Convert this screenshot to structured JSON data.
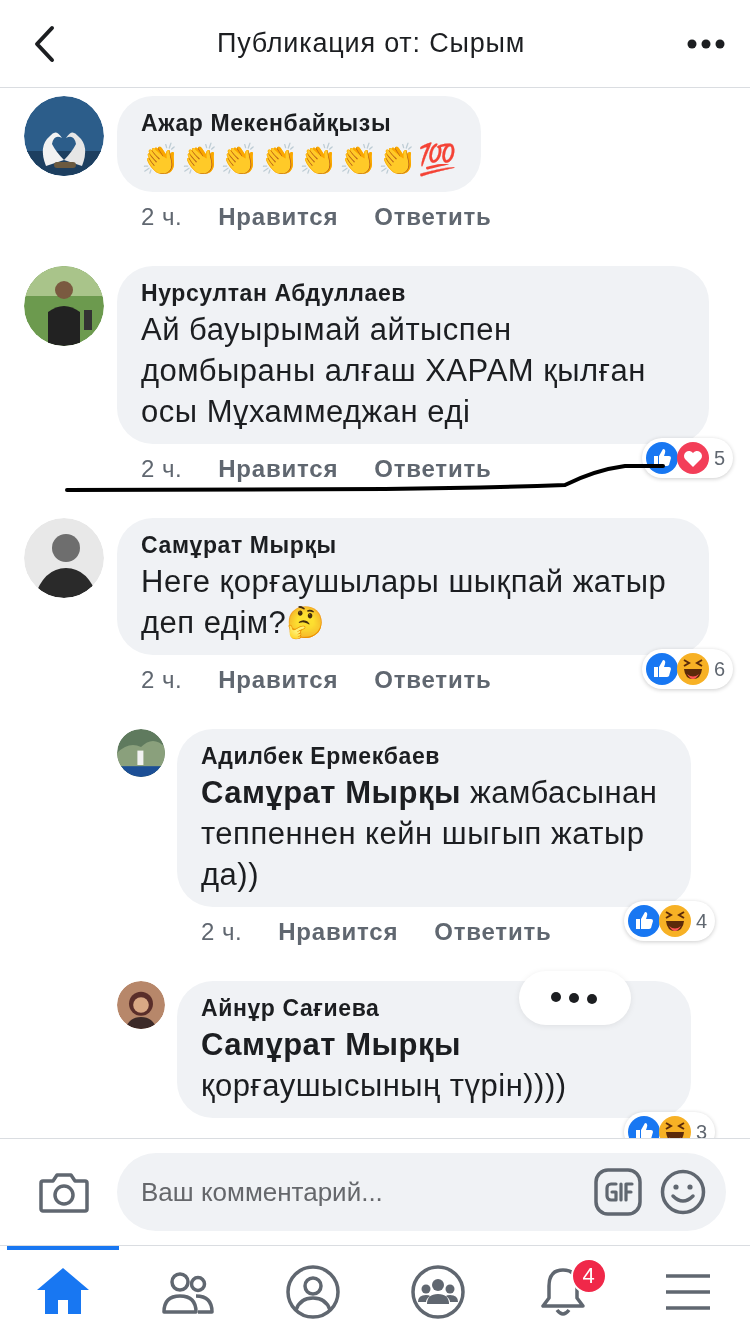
{
  "header": {
    "title": "Публикация от: Сырым"
  },
  "comments": [
    {
      "author": "Ажар Мекенбайқызы",
      "text": "👏👏👏👏👏👏👏💯",
      "time": "2 ч.",
      "like": "Нравится",
      "reply": "Ответить"
    },
    {
      "author": "Нурсултан Абдуллаев",
      "text": "Ай бауырымай айтыспен домбыраны алғаш ХАРАМ қылған осы Мұхаммеджан еді",
      "time": "2 ч.",
      "like": "Нравится",
      "reply": "Ответить",
      "reactions": [
        {
          "kind": "like"
        },
        {
          "kind": "love"
        }
      ],
      "reaction_count": "5",
      "scribbled": true
    },
    {
      "author": "Самұрат Мырқы",
      "text": "Неге қорғаушылары шықпай жатыр деп едім?🤔",
      "time": "2 ч.",
      "like": "Нравится",
      "reply": "Ответить",
      "reactions": [
        {
          "kind": "like"
        },
        {
          "kind": "haha"
        }
      ],
      "reaction_count": "6",
      "children": [
        {
          "author": "Адилбек Ермекбаев",
          "text": "**Самұрат Мырқы** жамбасынан теппеннен кейн шыгып жатыр да))",
          "time": "2 ч.",
          "like": "Нравится",
          "reply": "Ответить",
          "reactions": [
            {
              "kind": "like"
            },
            {
              "kind": "haha"
            }
          ],
          "reaction_count": "4"
        },
        {
          "author": "Айнұр Сағиева",
          "text": "**Самұрат Мырқы** қорғаушысының түрін))))",
          "reactions": [
            {
              "kind": "like"
            },
            {
              "kind": "haha"
            }
          ],
          "reaction_count": "3"
        }
      ]
    }
  ],
  "composer": {
    "placeholder": "Ваш комментарий..."
  },
  "tabs": [
    {
      "kind": "home",
      "selected": true
    },
    {
      "kind": "friends",
      "selected": false
    },
    {
      "kind": "profile",
      "selected": false
    },
    {
      "kind": "groups",
      "selected": false
    },
    {
      "kind": "notifications",
      "selected": false,
      "badge": "4"
    },
    {
      "kind": "menu",
      "selected": false
    }
  ]
}
